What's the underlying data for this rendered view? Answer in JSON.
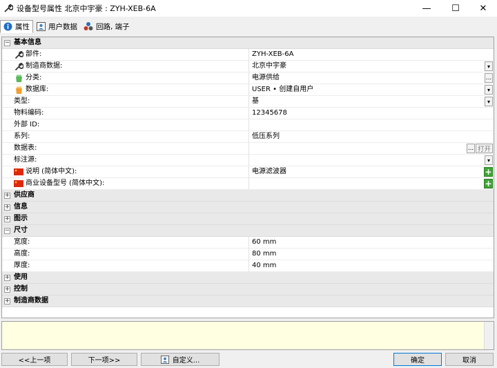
{
  "window": {
    "title": "设备型号属性 北京中宇豪 : ZYH-XEB-6A",
    "minimize": "—",
    "maximize": "☐",
    "close": "✕"
  },
  "tabs": [
    {
      "label": "属性",
      "icon": "info-icon"
    },
    {
      "label": "用户数据",
      "icon": "user-data-icon"
    },
    {
      "label": "回路, 端子",
      "icon": "circuit-icon"
    }
  ],
  "grid": {
    "basic": {
      "title": "基本信息",
      "rows": [
        {
          "label": "部件:",
          "value": "ZYH-XEB-6A",
          "icon": "wrench-icon"
        },
        {
          "label": "制造商数据:",
          "value": "北京中宇豪",
          "icon": "wrench-icon"
        },
        {
          "label": "分类:",
          "value": "电源供给",
          "icon": "category-icon"
        },
        {
          "label": "数据库:",
          "value": "USER • 创建自用户",
          "icon": "database-icon"
        },
        {
          "label": "类型:",
          "value": "基"
        },
        {
          "label": "物料编码:",
          "value": "12345678"
        },
        {
          "label": "外部 ID:",
          "value": ""
        },
        {
          "label": "系列:",
          "value": "低压系列"
        },
        {
          "label": "数据表:",
          "value": "",
          "open_label": "打开"
        },
        {
          "label": "标注源:",
          "value": ""
        },
        {
          "label": "说明 (简体中文):",
          "value": "电源滤波器",
          "icon": "flag-cn-icon"
        },
        {
          "label": "商业设备型号 (简体中文):",
          "value": "",
          "icon": "flag-cn-icon"
        }
      ]
    },
    "groups_collapsed_1": [
      "供应商",
      "信息",
      "图示"
    ],
    "size": {
      "title": "尺寸",
      "rows": [
        {
          "label": "宽度:",
          "value": "60 mm"
        },
        {
          "label": "高度:",
          "value": "80 mm"
        },
        {
          "label": "厚度:",
          "value": "40 mm"
        }
      ]
    },
    "groups_collapsed_2": [
      "使用",
      "控制",
      "制造商数据"
    ],
    "expanded_marker": "−",
    "collapsed_marker": "+"
  },
  "buttons": {
    "prev": "<<上一项",
    "next": "下一项>>",
    "customize": "自定义...",
    "ok": "确定",
    "cancel": "取消",
    "more": "...",
    "plus": "+",
    "drop": "▾"
  }
}
